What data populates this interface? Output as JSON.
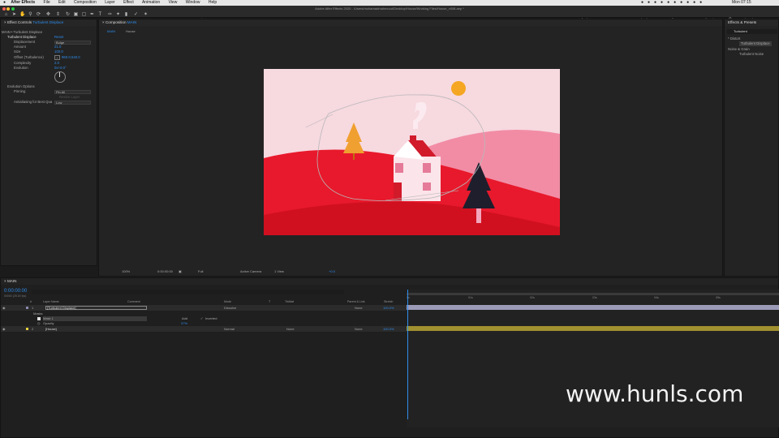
{
  "menubar": {
    "apple": "",
    "items": [
      "After Effects",
      "File",
      "Edit",
      "Composition",
      "Layer",
      "Effect",
      "Animation",
      "View",
      "Window",
      "Help"
    ],
    "right": [
      "Mon 07:15"
    ],
    "colors": {
      "bg": "#e6e6e6"
    }
  },
  "window": {
    "title": "Adobe After Effects 2020 - /Users/mohamadmahmoud/Desktop/House/Working Files/House_v008.aep *"
  },
  "toolbar": {
    "rotobezier_label": "RotoBezier",
    "search_label": "Search Help",
    "workspaces": [
      "Default",
      "Learn",
      "Standard",
      "Small Screen",
      "Libraries"
    ]
  },
  "effect_controls": {
    "tab_label": "Effect Controls",
    "tab_layer": "Turbulent Displace",
    "breadcrumb": "MAIN • Turbulent Displace",
    "effect_name": "Turbulent Displace",
    "reset": "Reset",
    "props": [
      {
        "label": "Displacement",
        "value": "Bulge",
        "kind": "select"
      },
      {
        "label": "Amount",
        "value": "21.0",
        "kind": "value"
      },
      {
        "label": "Size",
        "value": "100.0",
        "kind": "value"
      },
      {
        "label": "Offset (Turbulence)",
        "value": "960.0,540.0",
        "kind": "point"
      },
      {
        "label": "Complexity",
        "value": "2.0",
        "kind": "value"
      },
      {
        "label": "Evolution",
        "value": "0x+0.0°",
        "kind": "value"
      }
    ],
    "evolution_options": "Evolution Options",
    "pinning_label": "Pinning",
    "pinning_value": "Pin All",
    "resize_layer": "Resize Layer",
    "antialias_label": "Antialiasing for Best Qua",
    "antialias_value": "Low"
  },
  "composition": {
    "tab_label": "Composition",
    "tab_name": "MAIN",
    "subtabs": [
      "MAIN",
      "House"
    ],
    "footer": {
      "zoom": "100%",
      "time": "0:00:00:00",
      "resolution": "Full",
      "camera": "Active Camera",
      "views": "1 View",
      "exposure": "+0.0"
    }
  },
  "effects_presets": {
    "tab_label": "Effects & Presets",
    "search_value": "Turbulent",
    "categories": [
      {
        "name": "* Distort",
        "items": [
          "Turbulent Displace"
        ]
      },
      {
        "name": "Noise & Grain",
        "items": [
          "Turbulent Noise"
        ]
      }
    ]
  },
  "timeline": {
    "tab_label": "MAIN",
    "timecode": "0:00:00:00",
    "frames_label": "00000 (25.00 fps)",
    "columns": [
      "#",
      "Layer Name",
      "Comment",
      "Mode",
      "T",
      "TrkMat",
      "Parent & Link",
      "Stretch"
    ],
    "layers": [
      {
        "num": "1",
        "name": "[Turbulent Displace]",
        "mode": "Dissolve",
        "parent": "None",
        "stretch": "100.0%"
      },
      {
        "num": "2",
        "name": "[House]",
        "mode": "Normal",
        "trkmat": "None",
        "parent": "None",
        "stretch": "100.0%"
      }
    ],
    "masks_label": "Masks",
    "mask1_label": "Mask 1",
    "mask_mode": "Add",
    "inverted_label": "Inverted",
    "opacity_label": "Opacity",
    "opacity_value": "37%",
    "ruler": [
      "0s",
      "01s",
      "02s",
      "03s",
      "04s",
      "05s"
    ]
  },
  "watermark": "www.hunls.com",
  "colors": {
    "accent": "#2d8ceb",
    "sky": "#f7d9e0",
    "hill_red": "#e8192c",
    "hill_pink": "#f28ca5",
    "sun": "#f5a623",
    "tree": "#f0a030",
    "dark_tree": "#1e1e2d",
    "layer_bar": "#9b9bb8",
    "layer2_bar": "#a09030"
  }
}
